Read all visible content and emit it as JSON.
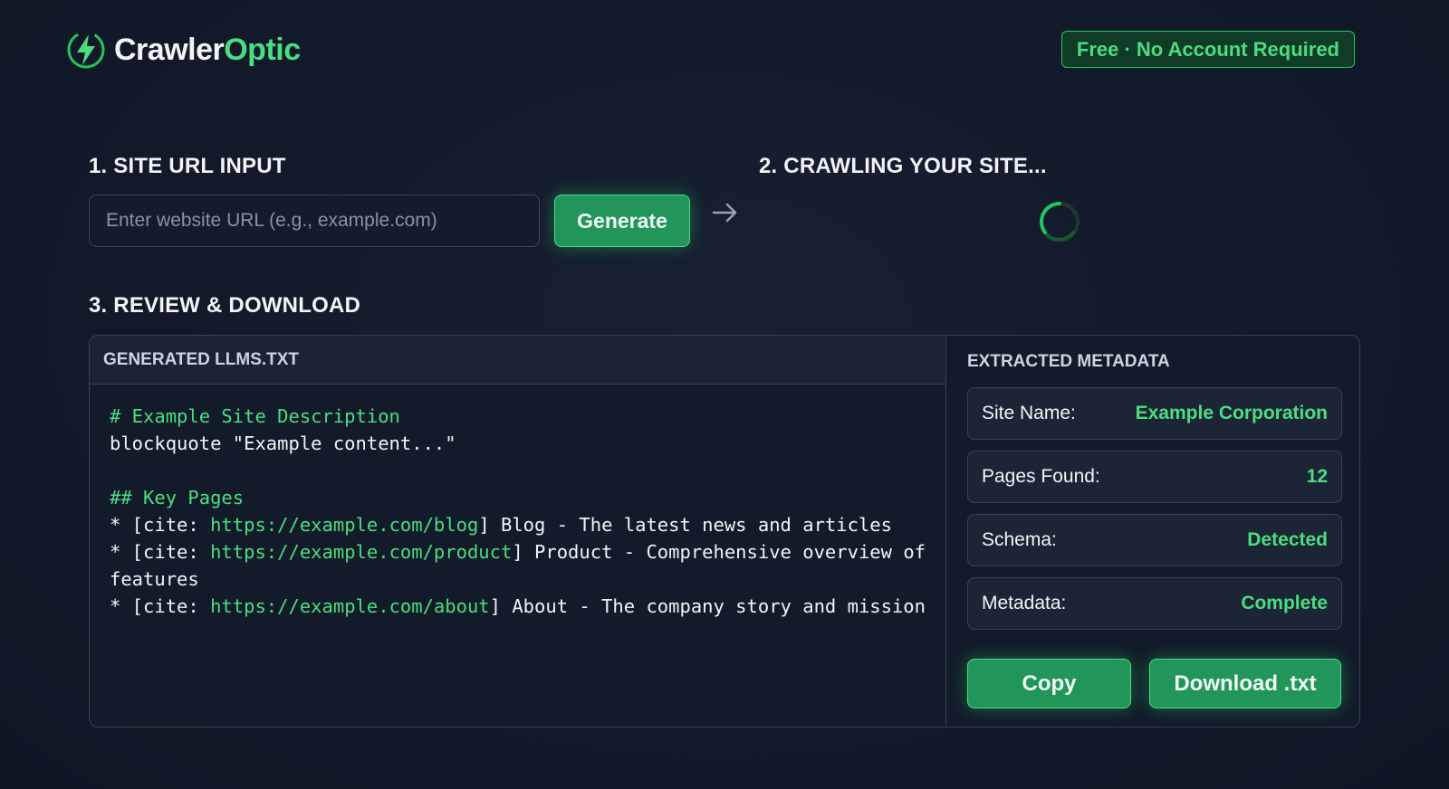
{
  "brand": {
    "name_part1": "Crawler",
    "name_part2": "Optic",
    "badge": "Free · No Account Required"
  },
  "step1": {
    "title": "1. SITE URL INPUT",
    "placeholder": "Enter website URL (e.g., example.com)",
    "value": "",
    "generate_label": "Generate"
  },
  "step2": {
    "title": "2. CRAWLING YOUR SITE..."
  },
  "step3": {
    "title": "3. REVIEW & DOWNLOAD"
  },
  "output": {
    "header": "GENERATED LLMS.TXT",
    "lines": [
      {
        "comment": "# Example Site Description"
      },
      {
        "text": "blockquote \"Example content...\""
      },
      {
        "text": ""
      },
      {
        "comment": "## Key Pages"
      },
      {
        "prefix": "* [cite: ",
        "link": "https://example.com/blog",
        "suffix": "] Blog - The latest news and articles"
      },
      {
        "prefix": "* [cite: ",
        "link": "https://example.com/product",
        "suffix": "] Product - Comprehensive overview of features"
      },
      {
        "prefix": "* [cite: ",
        "link": "https://example.com/about",
        "suffix": "] About - The company story and mission"
      }
    ]
  },
  "metadata": {
    "header": "EXTRACTED METADATA",
    "rows": [
      {
        "label": "Site Name:",
        "value": "Example Corporation"
      },
      {
        "label": "Pages Found:",
        "value": "12"
      },
      {
        "label": "Schema:",
        "value": "Detected"
      },
      {
        "label": "Metadata:",
        "value": "Complete"
      }
    ],
    "copy_label": "Copy",
    "download_label": "Download .txt"
  },
  "colors": {
    "accent": "#4ade80",
    "button": "#22955a",
    "background": "#131b2b"
  }
}
